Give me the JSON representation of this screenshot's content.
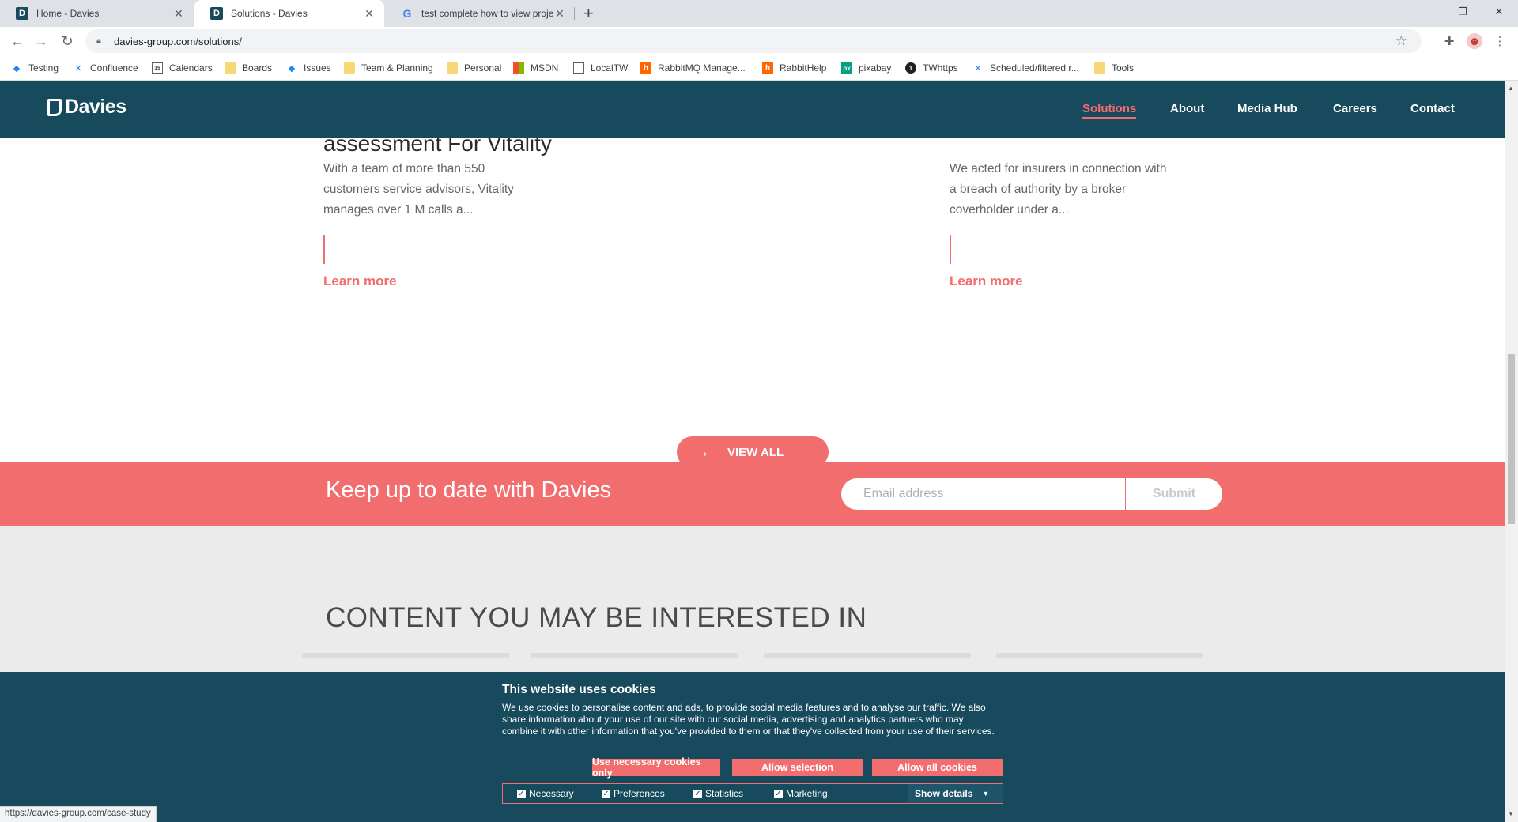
{
  "browser": {
    "tabs": [
      {
        "title": "Home - Davies",
        "icon": "davies-favicon"
      },
      {
        "title": "Solutions - Davies",
        "icon": "davies-favicon"
      },
      {
        "title": "test complete how to view proje",
        "icon": "google-favicon"
      }
    ],
    "new_tab": "+",
    "url": "davies-group.com/solutions/",
    "bookmarks": [
      {
        "label": "Testing",
        "icon": "jira-icon"
      },
      {
        "label": "Confluence",
        "icon": "confluence-icon"
      },
      {
        "label": "Calendars",
        "icon": "calendar-icon"
      },
      {
        "label": "Boards",
        "icon": "folder-icon"
      },
      {
        "label": "Issues",
        "icon": "jira-icon"
      },
      {
        "label": "Team & Planning",
        "icon": "folder-icon"
      },
      {
        "label": "Personal",
        "icon": "folder-icon"
      },
      {
        "label": "MSDN",
        "icon": "microsoft-icon"
      },
      {
        "label": "LocalTW",
        "icon": "laptop-icon"
      },
      {
        "label": "RabbitMQ Manage...",
        "icon": "rabbitmq-icon"
      },
      {
        "label": "RabbitHelp",
        "icon": "rabbitmq-icon"
      },
      {
        "label": "pixabay",
        "icon": "pixabay-icon"
      },
      {
        "label": "TWhttps",
        "icon": "tw-icon"
      },
      {
        "label": "Scheduled/filtered r...",
        "icon": "confluence-icon"
      },
      {
        "label": "Tools",
        "icon": "folder-icon"
      }
    ],
    "status_url": "https://davies-group.com/case-study"
  },
  "site": {
    "logo_text": "Davies",
    "nav": [
      {
        "label": "Solutions",
        "active": true
      },
      {
        "label": "About",
        "active": false
      },
      {
        "label": "Media Hub",
        "active": false
      },
      {
        "label": "Careers",
        "active": false
      },
      {
        "label": "Contact",
        "active": false
      }
    ],
    "cards": [
      {
        "title": "assessment For Vitality",
        "text": [
          "With a team of more than 550",
          "customers service advisors, Vitality",
          "manages over 1 M calls a..."
        ],
        "link": "Learn more"
      },
      {
        "title": "",
        "text": [
          "We acted for insurers in connection with",
          "a breach of authority by a broker",
          "coverholder under a..."
        ],
        "link": "Learn more"
      }
    ],
    "view_all": "VIEW ALL",
    "newsletter": {
      "title": "Keep up to date with Davies",
      "email_placeholder": "Email address",
      "submit": "Submit"
    },
    "interested_heading": "CONTENT YOU MAY BE INTERESTED IN"
  },
  "cookie_banner": {
    "title": "This website uses cookies",
    "text": "We use cookies to personalise content and ads, to provide social media features and to analyse our traffic. We also share information about your use of our site with our social media, advertising and analytics partners who may combine it with other information that you've provided to them or that they've collected from your use of their services.",
    "buttons": [
      "Use necessary cookies only",
      "Allow selection",
      "Allow all cookies"
    ],
    "choices": [
      {
        "label": "Necessary",
        "checked": true
      },
      {
        "label": "Preferences",
        "checked": true
      },
      {
        "label": "Statistics",
        "checked": true
      },
      {
        "label": "Marketing",
        "checked": true
      }
    ],
    "show_details": "Show details"
  },
  "colors": {
    "brand_teal": "#174a5c",
    "accent_coral": "#f26d6d"
  }
}
